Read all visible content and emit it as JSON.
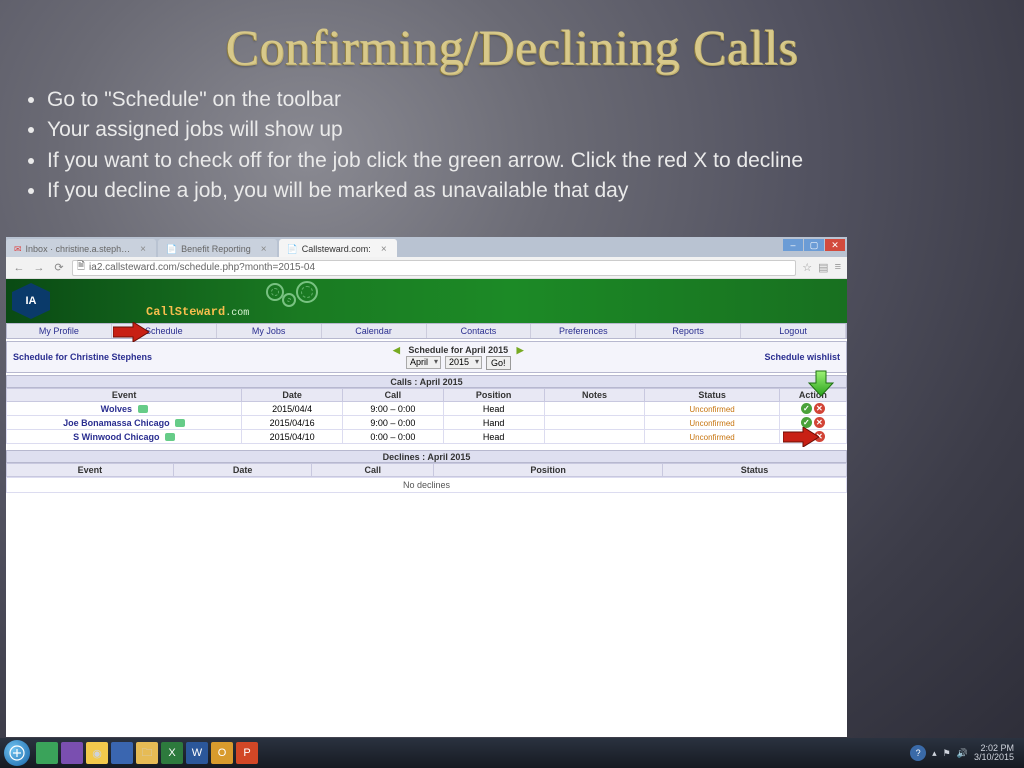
{
  "slide": {
    "title": "Confirming/Declining Calls",
    "bullets": [
      "Go to \"Schedule\" on the toolbar",
      "Your assigned jobs will show up",
      "If you want to check off for the job click the green arrow.  Click the red X to decline",
      "If you decline a job, you will be marked as unavailable that day"
    ]
  },
  "browser": {
    "tabs": [
      {
        "label": "Inbox · christine.a.steph…"
      },
      {
        "label": "Benefit Reporting"
      },
      {
        "label": "Callsteward.com:"
      }
    ],
    "url": "ia2.callsteward.com/schedule.php?month=2015-04",
    "brand_a": "CallSteward",
    "brand_b": ".com"
  },
  "nav": [
    "My Profile",
    "Schedule",
    "My Jobs",
    "Calendar",
    "Contacts",
    "Preferences",
    "Reports",
    "Logout"
  ],
  "subheader": {
    "user": "Schedule for Christine Stephens",
    "title": "Schedule for April 2015",
    "month": "April",
    "year": "2015",
    "go": "Go!",
    "wishlist": "Schedule wishlist"
  },
  "calls": {
    "section": "Calls : April 2015",
    "headers": [
      "Event",
      "Date",
      "Call",
      "Position",
      "Notes",
      "Status",
      "Action"
    ],
    "rows": [
      {
        "event": "Wolves",
        "date": "2015/04/4",
        "call": "9:00 – 0:00",
        "position": "Head",
        "notes": "",
        "status": "Unconfirmed"
      },
      {
        "event": "Joe Bonamassa Chicago",
        "date": "2015/04/16",
        "call": "9:00 – 0:00",
        "position": "Hand",
        "notes": "",
        "status": "Unconfirmed"
      },
      {
        "event": "S Winwood Chicago",
        "date": "2015/04/10",
        "call": "0:00 – 0:00",
        "position": "Head",
        "notes": "",
        "status": "Unconfirmed"
      }
    ]
  },
  "declines": {
    "section": "Declines : April 2015",
    "headers": [
      "Event",
      "Date",
      "Call",
      "Position",
      "Status"
    ],
    "empty": "No declines"
  },
  "taskbar": {
    "time": "2:02 PM",
    "date": "3/10/2015"
  }
}
